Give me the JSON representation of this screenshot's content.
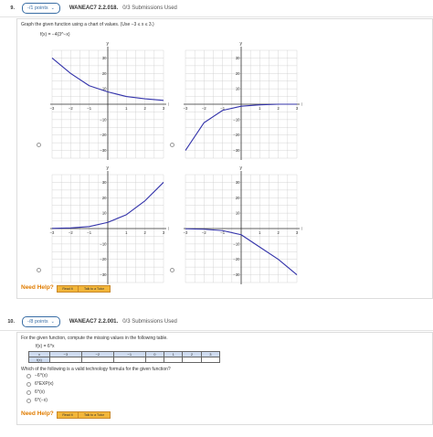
{
  "q9": {
    "number": "9.",
    "points": "-/1 points",
    "id": "WANEAC7 2.2.018.",
    "submissions": "0/3 Submissions Used",
    "instruction": "Graph the given function using a chart of values. (Use −3 ≤ x ≤ 3.)",
    "function": "f(x) = −4(3^−x)",
    "axis_x": "x",
    "axis_y": "y",
    "x_ticks": [
      "−3",
      "−2",
      "−1",
      "1",
      "2",
      "3"
    ],
    "y_ticks": [
      "30",
      "20",
      "10",
      "−10",
      "−20",
      "−30"
    ],
    "need_help": "Need Help?",
    "read_it": "Read It",
    "talk_tutor": "Talk to a Tutor"
  },
  "q10": {
    "number": "10.",
    "points": "-/8 points",
    "id": "WANEAC7 2.2.001.",
    "submissions": "0/3 Submissions Used",
    "instruction": "For the given function, compute the missing values in the following table.",
    "function": "f(x) = 6^x",
    "table_x_label": "x",
    "table_f_label": "f(x)",
    "table_x": [
      "−3",
      "−2",
      "−1",
      "0",
      "1",
      "2",
      "3"
    ],
    "question": "Which of the following is a valid technology formula for the given function?",
    "options": [
      "−6^(x)",
      "6*EXP(x)",
      "6^(x)",
      "6^(−x)"
    ],
    "need_help": "Need Help?",
    "read_it": "Read It",
    "talk_tutor": "Talk to a Tutor"
  },
  "colors": {
    "curve": "#3333aa",
    "axis": "#333333",
    "grid": "#cccccc",
    "accent": "#3a6ea5",
    "help": "#e07c00"
  },
  "chart_data": [
    {
      "type": "line",
      "title": "",
      "xlim": [
        -3,
        3
      ],
      "ylim": [
        -35,
        35
      ],
      "series": [
        {
          "x": [
            -3,
            -2,
            -1,
            0,
            1,
            2,
            3
          ],
          "y": [
            30,
            20,
            12,
            8,
            5,
            3.5,
            2.5
          ]
        }
      ]
    },
    {
      "type": "line",
      "title": "",
      "xlim": [
        -3,
        3
      ],
      "ylim": [
        -35,
        35
      ],
      "series": [
        {
          "x": [
            -3,
            -2,
            -1,
            0,
            1,
            2,
            3
          ],
          "y": [
            -30,
            -12,
            -4,
            -1.3,
            -0.4,
            0,
            0
          ]
        }
      ]
    },
    {
      "type": "line",
      "title": "",
      "xlim": [
        -3,
        3
      ],
      "ylim": [
        -35,
        35
      ],
      "series": [
        {
          "x": [
            -3,
            -2,
            -1,
            0,
            1,
            2,
            3
          ],
          "y": [
            0.1,
            0.4,
            1.3,
            4,
            9,
            18,
            30
          ]
        }
      ]
    },
    {
      "type": "line",
      "title": "",
      "xlim": [
        -3,
        3
      ],
      "ylim": [
        -35,
        35
      ],
      "series": [
        {
          "x": [
            -3,
            -2,
            -1,
            0,
            1,
            2,
            3
          ],
          "y": [
            -0.15,
            -0.44,
            -1.33,
            -4,
            -12,
            -20,
            -30
          ]
        }
      ]
    }
  ]
}
